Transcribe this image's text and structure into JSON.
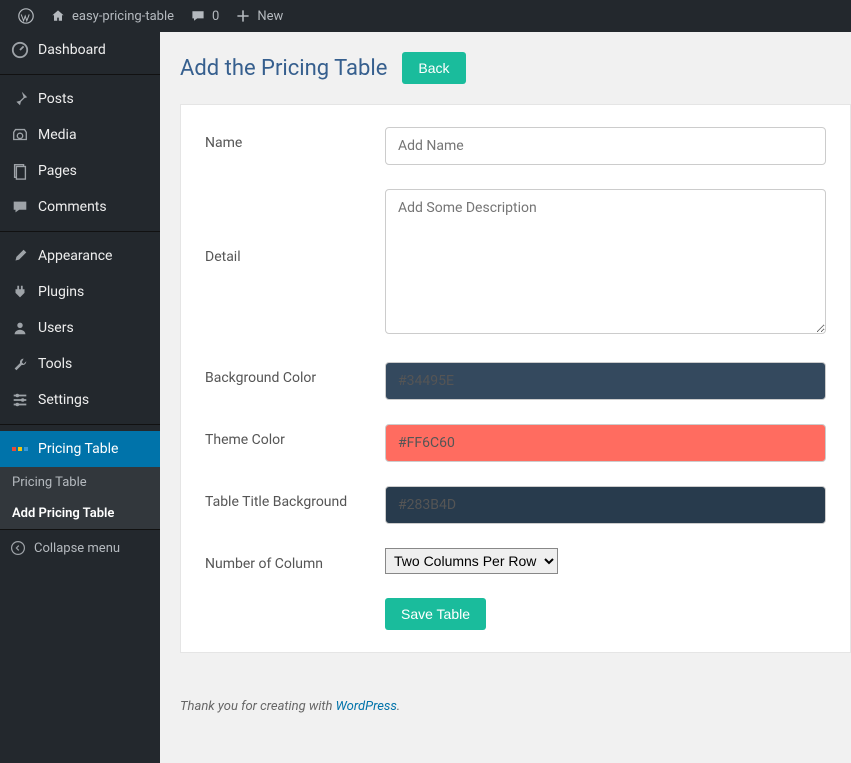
{
  "adminbar": {
    "site_name": "easy-pricing-table",
    "comments_count": "0",
    "new_label": "New"
  },
  "sidebar": {
    "dashboard": "Dashboard",
    "posts": "Posts",
    "media": "Media",
    "pages": "Pages",
    "comments": "Comments",
    "appearance": "Appearance",
    "plugins": "Plugins",
    "users": "Users",
    "tools": "Tools",
    "settings": "Settings",
    "pricing_table": "Pricing Table",
    "sub_pricing_table": "Pricing Table",
    "sub_add_pricing_table": "Add Pricing Table",
    "collapse": "Collapse menu"
  },
  "page": {
    "title": "Add the Pricing Table",
    "back_button": "Back"
  },
  "form": {
    "name_label": "Name",
    "name_placeholder": "Add Name",
    "name_value": "",
    "detail_label": "Detail",
    "detail_placeholder": "Add Some Description",
    "detail_value": "",
    "bg_color_label": "Background Color",
    "bg_color_value": "#34495E",
    "theme_color_label": "Theme Color",
    "theme_color_value": "#FF6C60",
    "title_bg_label": "Table Title Background",
    "title_bg_value": "#283B4D",
    "num_col_label": "Number of Column",
    "num_col_selected": "Two Columns Per Row",
    "save_button": "Save Table"
  },
  "footer": {
    "prefix": "Thank you for creating with ",
    "link_text": "WordPress",
    "suffix": "."
  }
}
